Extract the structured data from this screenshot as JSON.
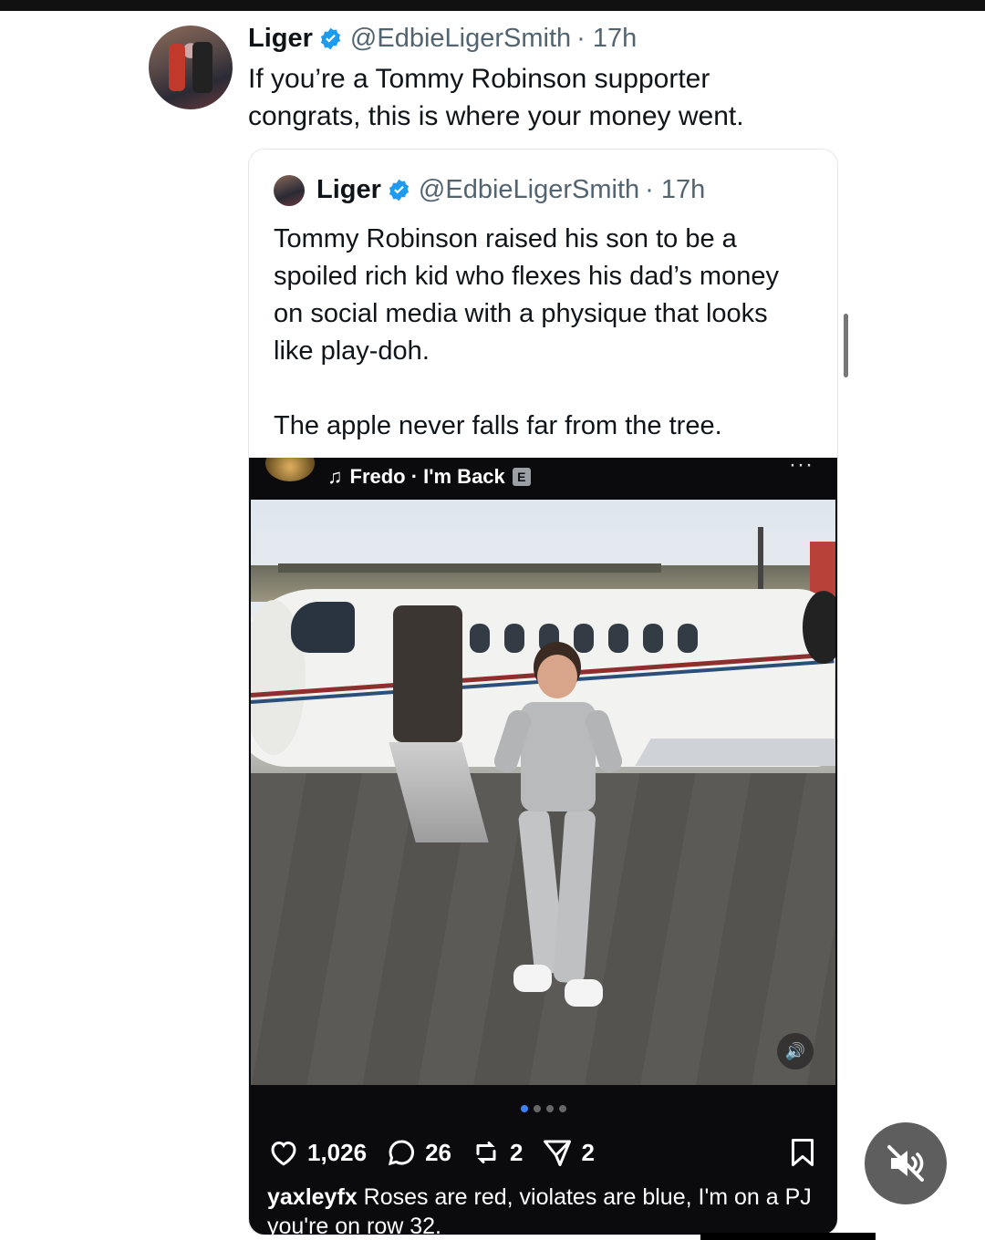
{
  "tweet": {
    "name": "Liger",
    "handle": "@EdbieLigerSmith",
    "time": "· 17h",
    "text": "If you’re a Tommy Robinson supporter congrats, this is where your money went."
  },
  "quoted": {
    "name": "Liger",
    "handle": "@EdbieLigerSmith",
    "time": "· 17h",
    "text_1": "Tommy Robinson raised his son to be a spoiled rich kid who flexes his dad’s money on social media with a physique that looks like play-doh.",
    "text_2": "The apple never falls far from the tree."
  },
  "media": {
    "music_note": "♫",
    "music": "Fredo · I'm Back",
    "explicit_badge": "E",
    "more": "···",
    "volume_icon": "speaker-icon",
    "carousel": {
      "count": 4,
      "active": 0
    },
    "likes": "1,026",
    "comments": "26",
    "reposts": "2",
    "shares": "2",
    "caption_user": "yaxleyfx",
    "caption_text": " Roses are red, violates are blue, I'm on a PJ you're on row 32."
  },
  "colors": {
    "verified": "#1d9bf0",
    "handle": "#536471",
    "mute_button": "#5e5e5e"
  },
  "icons": [
    "verified-icon",
    "heart-icon",
    "comment-icon",
    "repost-icon",
    "share-icon",
    "bookmark-icon",
    "mute-icon"
  ]
}
